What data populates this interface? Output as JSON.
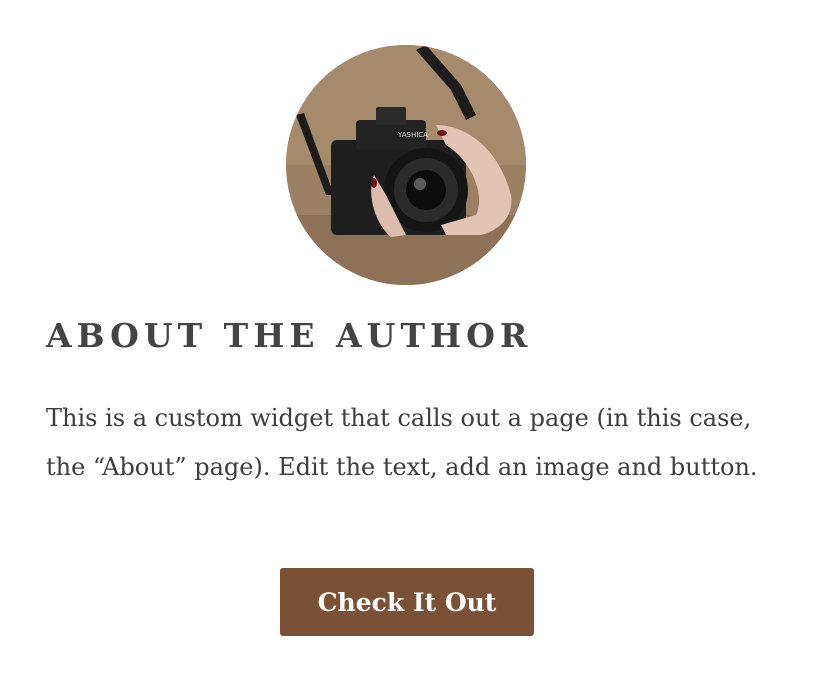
{
  "widget": {
    "title": "ABOUT THE AUTHOR",
    "body": "This is a custom widget that calls out a page (in this case, the “About” page). Edit the text, add an image and button.",
    "button_label": "Check It Out",
    "image_icon": "camera-photo",
    "camera_brand": "YASHICA"
  },
  "colors": {
    "button_bg": "#7a5135",
    "title": "#444444",
    "text": "#3d3d3d",
    "photo_bg": "#9c8064"
  }
}
